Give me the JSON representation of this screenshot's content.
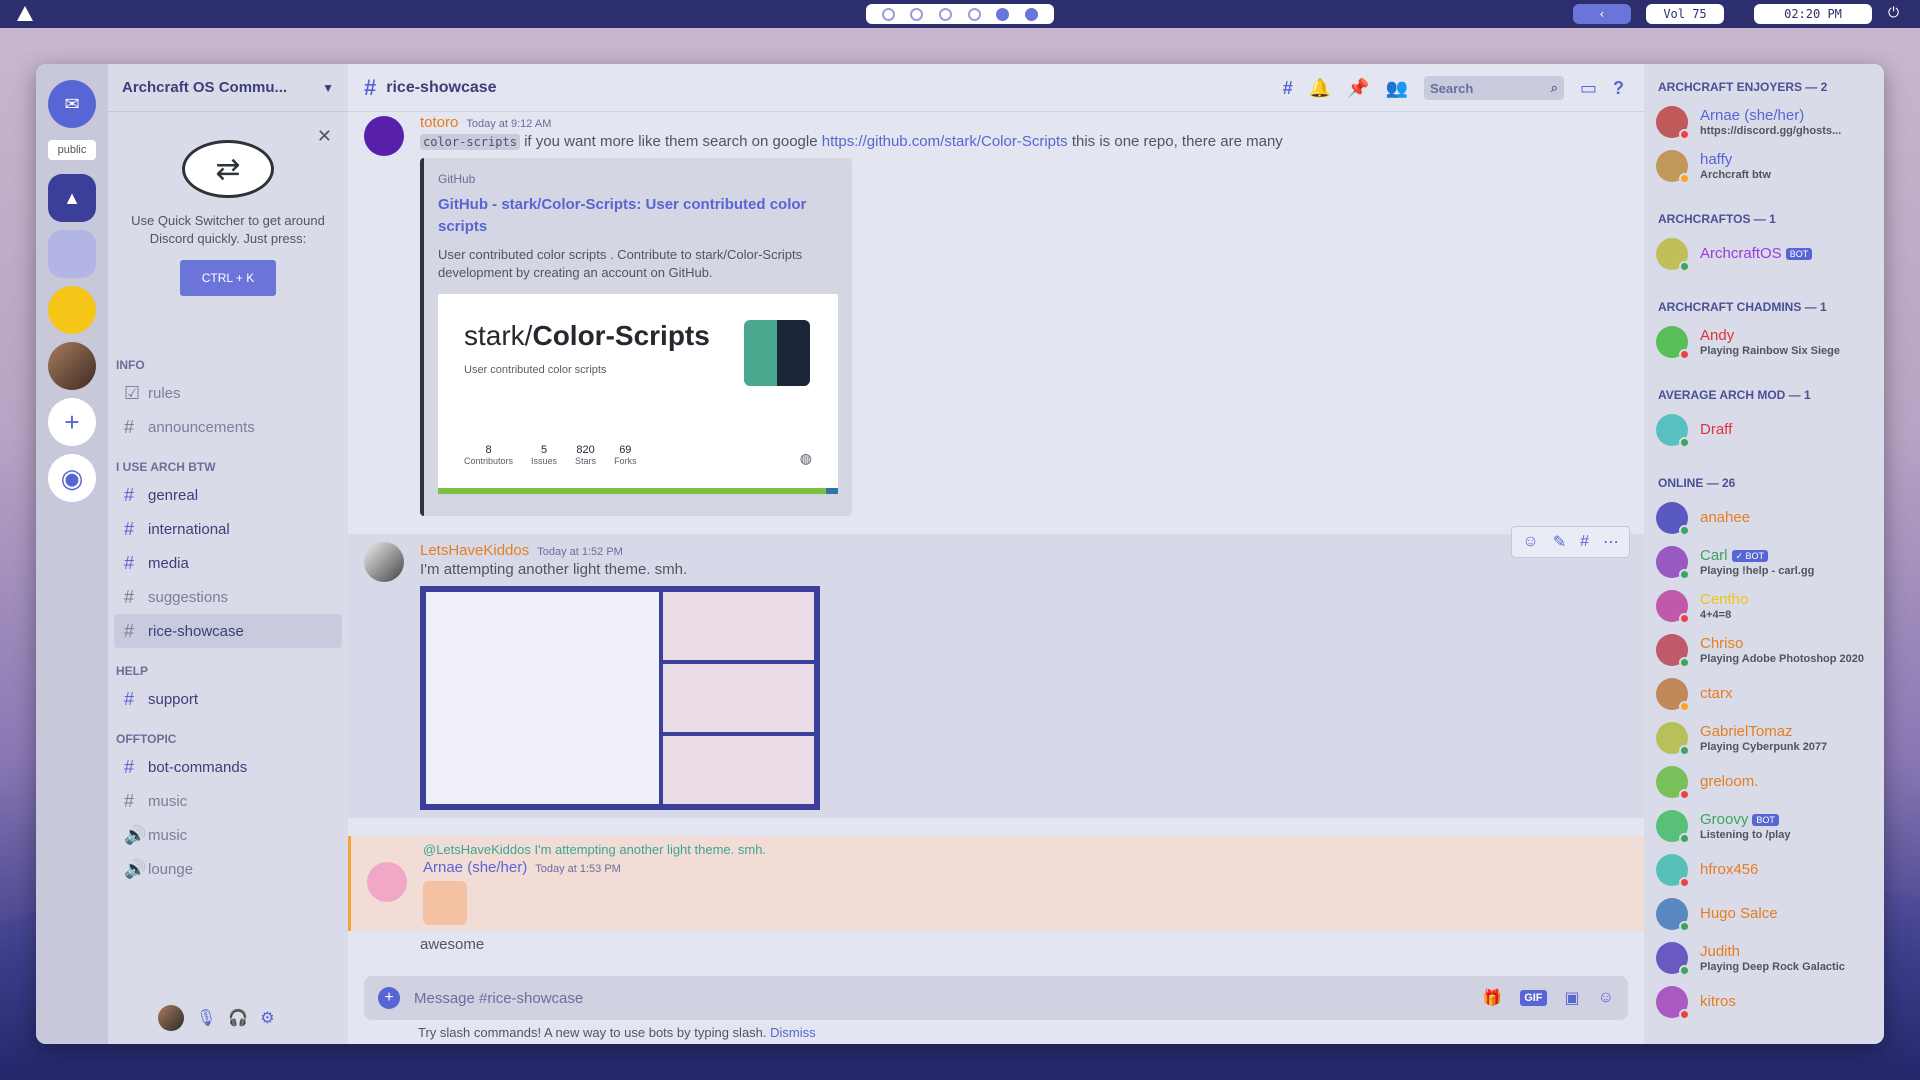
{
  "topbar": {
    "workspaces": 6,
    "active_workspace": 5,
    "volume": "Vol 75",
    "clock": "02:20 PM"
  },
  "guilds": {
    "public_label": "public"
  },
  "server": {
    "name": "Archcraft OS Commu..."
  },
  "quick_switcher": {
    "text": "Use Quick Switcher to get around Discord quickly. Just press:",
    "shortcut": "CTRL + K"
  },
  "categories": [
    {
      "name": "INFO",
      "channels": [
        {
          "name": "rules",
          "icon": "rules-icon"
        },
        {
          "name": "announcements",
          "icon": "hash-icon"
        }
      ]
    },
    {
      "name": "I USE ARCH BTW",
      "channels": [
        {
          "name": "genreal",
          "icon": "hash-icon"
        },
        {
          "name": "international",
          "icon": "hash-icon"
        },
        {
          "name": "media",
          "icon": "hash-icon"
        },
        {
          "name": "suggestions",
          "icon": "hash-icon"
        },
        {
          "name": "rice-showcase",
          "icon": "hash-icon"
        }
      ]
    },
    {
      "name": "HELP",
      "channels": [
        {
          "name": "support",
          "icon": "hash-icon"
        }
      ]
    },
    {
      "name": "OFFTOPIC",
      "channels": [
        {
          "name": "bot-commands",
          "icon": "hash-icon"
        },
        {
          "name": "music",
          "icon": "hash-icon"
        },
        {
          "name": "music",
          "icon": "voice-icon"
        },
        {
          "name": "lounge",
          "icon": "voice-icon"
        }
      ]
    }
  ],
  "chat": {
    "channel": "rice-showcase",
    "search_placeholder": "Search",
    "messages": [
      {
        "author": "totoro",
        "time": "Today at 9:12 AM",
        "code": "color-scripts",
        "text1": " if you want more like them search on google ",
        "link": "https://github.com/stark/Color-Scripts",
        "text2": " this is one repo, there are many",
        "embed": {
          "provider": "GitHub",
          "title": "GitHub - stark/Color-Scripts: User contributed color scripts",
          "description": "User contributed color scripts . Contribute to stark/Color-Scripts development by creating an account on GitHub.",
          "repo_owner": "stark/",
          "repo_name": "Color-Scripts",
          "repo_desc": "User contributed color scripts",
          "stats": [
            {
              "v": "8",
              "l": "Contributors"
            },
            {
              "v": "5",
              "l": "Issues"
            },
            {
              "v": "820",
              "l": "Stars"
            },
            {
              "v": "69",
              "l": "Forks"
            }
          ]
        }
      },
      {
        "author": "LetsHaveKiddos",
        "time": "Today at 1:52 PM",
        "text": "I'm attempting another light theme. smh."
      },
      {
        "author": "Arnae (she/her)",
        "time": "Today at 1:53 PM",
        "reply_to": "@LetsHaveKiddos",
        "reply_text": "I'm attempting another light theme. smh.",
        "text": "awesome"
      }
    ],
    "composer_placeholder": "Message #rice-showcase",
    "gif_label": "GIF",
    "tip": "Try slash commands! A new way to use bots by typing slash.",
    "dismiss": "Dismiss"
  },
  "members": [
    {
      "group": "ARCHCRAFT ENJOYERS — 2",
      "list": [
        {
          "name": "Arnae (she/her)",
          "status": "https://discord.gg/ghosts...",
          "color": "#5865d4",
          "state": "dnd"
        },
        {
          "name": "haffy",
          "status": "Archcraft btw",
          "color": "#5865d4",
          "state": "idle"
        }
      ]
    },
    {
      "group": "ARCHCRAFTOS — 1",
      "list": [
        {
          "name": "ArchcraftOS",
          "status": "",
          "color": "#9b3bd8",
          "state": "online",
          "badge": "BOT"
        }
      ]
    },
    {
      "group": "ARCHCRAFT CHADMINS — 1",
      "list": [
        {
          "name": "Andy",
          "status": "Playing Rainbow Six Siege",
          "color": "#e0323a",
          "state": "dnd"
        }
      ]
    },
    {
      "group": "AVERAGE ARCH MOD — 1",
      "list": [
        {
          "name": "Draff",
          "status": "",
          "color": "#e0323a",
          "state": "online"
        }
      ]
    },
    {
      "group": "ONLINE — 26",
      "list": [
        {
          "name": "anahee",
          "status": "",
          "color": "#e67e22",
          "state": "online"
        },
        {
          "name": "Carl",
          "status": "Playing !help - carl.gg",
          "color": "#3ba55d",
          "state": "online",
          "badge": "✓ BOT"
        },
        {
          "name": "Centho",
          "status": "4+4=8",
          "color": "#f1c40f",
          "state": "dnd"
        },
        {
          "name": "Chriso",
          "status": "Playing Adobe Photoshop 2020",
          "color": "#e67e22",
          "state": "online"
        },
        {
          "name": "ctarx",
          "status": "",
          "color": "#e67e22",
          "state": "idle"
        },
        {
          "name": "GabrielTomaz",
          "status": "Playing Cyberpunk 2077",
          "color": "#e67e22",
          "state": "online"
        },
        {
          "name": "greloom.",
          "status": "",
          "color": "#e67e22",
          "state": "dnd"
        },
        {
          "name": "Groovy",
          "status": "Listening to /play",
          "color": "#3ba55d",
          "state": "online",
          "badge": "BOT"
        },
        {
          "name": "hfrox456",
          "status": "",
          "color": "#e67e22",
          "state": "dnd"
        },
        {
          "name": "Hugo Salce",
          "status": "",
          "color": "#e67e22",
          "state": "online"
        },
        {
          "name": "Judith",
          "status": "Playing Deep Rock Galactic",
          "color": "#e67e22",
          "state": "online"
        },
        {
          "name": "kitros",
          "status": "",
          "color": "#e67e22",
          "state": "dnd"
        }
      ]
    }
  ]
}
